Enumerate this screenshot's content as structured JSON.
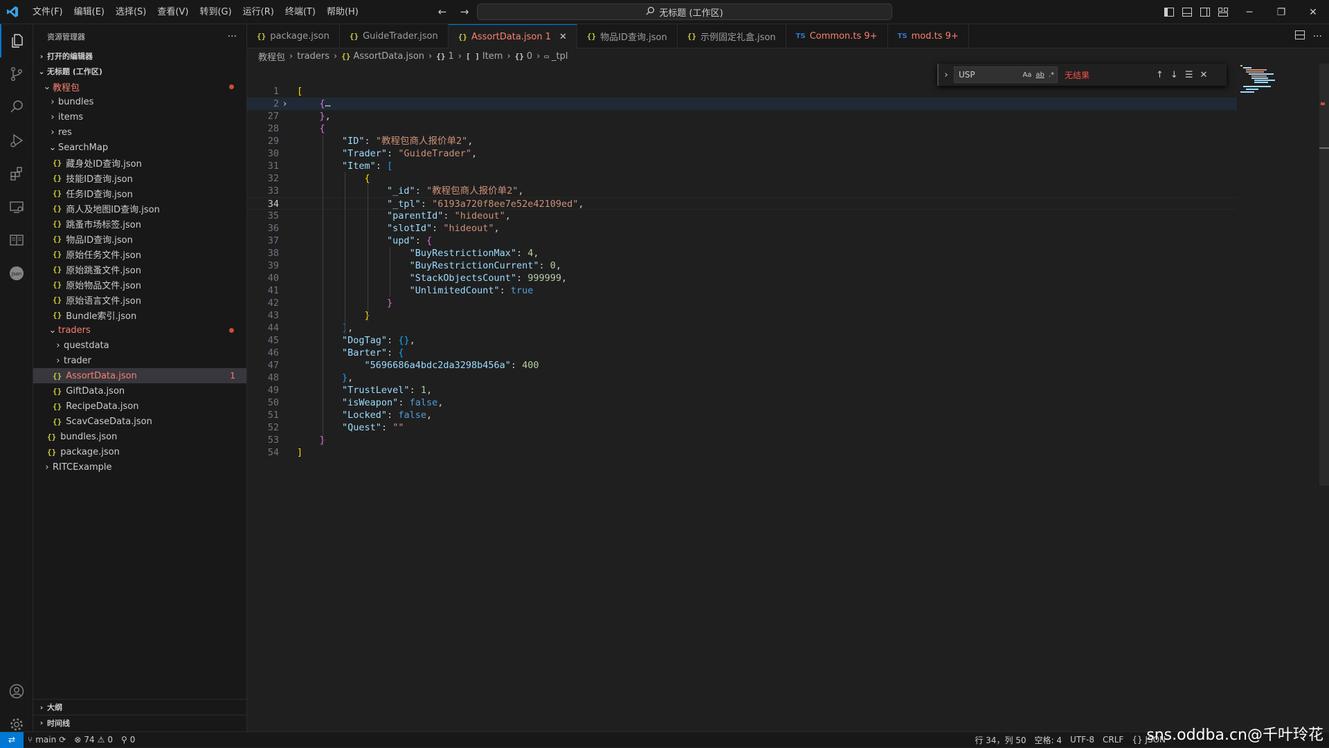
{
  "titlebar": {
    "menus": [
      "文件(F)",
      "编辑(E)",
      "选择(S)",
      "查看(V)",
      "转到(G)",
      "运行(R)",
      "终端(T)",
      "帮助(H)"
    ],
    "search_text": "无标题 (工作区)"
  },
  "sidebar": {
    "title": "资源管理器",
    "open_editors": "打开的编辑器",
    "workspace": "无标题 (工作区)",
    "root_folder": "教程包",
    "tree": [
      {
        "label": "bundles",
        "depth": 2,
        "type": "folder"
      },
      {
        "label": "items",
        "depth": 2,
        "type": "folder"
      },
      {
        "label": "res",
        "depth": 2,
        "type": "folder"
      },
      {
        "label": "SearchMap",
        "depth": 2,
        "type": "folder-open"
      },
      {
        "label": "藏身处ID查询.json",
        "depth": 3,
        "type": "json"
      },
      {
        "label": "技能ID查询.json",
        "depth": 3,
        "type": "json"
      },
      {
        "label": "任务ID查询.json",
        "depth": 3,
        "type": "json"
      },
      {
        "label": "商人及地图ID查询.json",
        "depth": 3,
        "type": "json"
      },
      {
        "label": "跳蚤市场标签.json",
        "depth": 3,
        "type": "json"
      },
      {
        "label": "物品ID查询.json",
        "depth": 3,
        "type": "json"
      },
      {
        "label": "原始任务文件.json",
        "depth": 3,
        "type": "json"
      },
      {
        "label": "原始跳蚤文件.json",
        "depth": 3,
        "type": "json"
      },
      {
        "label": "原始物品文件.json",
        "depth": 3,
        "type": "json"
      },
      {
        "label": "原始语言文件.json",
        "depth": 3,
        "type": "json"
      },
      {
        "label": "Bundle索引.json",
        "depth": 3,
        "type": "json"
      },
      {
        "label": "traders",
        "depth": 2,
        "type": "folder-open-err"
      },
      {
        "label": "questdata",
        "depth": 3,
        "type": "folder"
      },
      {
        "label": "trader",
        "depth": 3,
        "type": "folder"
      },
      {
        "label": "AssortData.json",
        "depth": 3,
        "type": "json-selected",
        "badge": "1"
      },
      {
        "label": "GiftData.json",
        "depth": 3,
        "type": "json"
      },
      {
        "label": "RecipeData.json",
        "depth": 3,
        "type": "json"
      },
      {
        "label": "ScavCaseData.json",
        "depth": 3,
        "type": "json"
      },
      {
        "label": "bundles.json",
        "depth": 2,
        "type": "json"
      },
      {
        "label": "package.json",
        "depth": 2,
        "type": "json"
      },
      {
        "label": "RITCExample",
        "depth": 1,
        "type": "folder"
      }
    ],
    "outline": "大纲",
    "timeline": "时间线"
  },
  "tabs": [
    {
      "label": "package.json",
      "icon": "{}",
      "active": false,
      "kind": "json"
    },
    {
      "label": "GuideTrader.json",
      "icon": "{}",
      "active": false,
      "kind": "json"
    },
    {
      "label": "AssortData.json 1",
      "icon": "{}",
      "active": true,
      "kind": "json"
    },
    {
      "label": "物品ID查询.json",
      "icon": "{}",
      "active": false,
      "kind": "json"
    },
    {
      "label": "示例固定礼盒.json",
      "icon": "{}",
      "active": false,
      "kind": "json"
    },
    {
      "label": "Common.ts 9+",
      "icon": "TS",
      "active": false,
      "kind": "ts"
    },
    {
      "label": "mod.ts 9+",
      "icon": "TS",
      "active": false,
      "kind": "ts"
    }
  ],
  "breadcrumb": [
    "教程包",
    "traders",
    "AssortData.json",
    "1",
    "Item",
    "0",
    "_tpl"
  ],
  "find": {
    "query": "USP",
    "opts": [
      "Aa",
      "ab",
      ".*"
    ],
    "result": "无结果"
  },
  "editor": {
    "current_line": "34",
    "lines": [
      {
        "n": "1",
        "html": "<span class='br1'>[</span>"
      },
      {
        "n": "2",
        "html": "    <span class='br2'>{</span><span class='p'>…</span>",
        "fold": true
      },
      {
        "n": "27",
        "html": "    <span class='br2'>}</span><span class='p'>,</span>"
      },
      {
        "n": "28",
        "html": "    <span class='br2'>{</span>"
      },
      {
        "n": "29",
        "html": "        <span class='k'>\"ID\"</span><span class='p'>: </span><span class='s'>\"教程包商人报价单2\"</span><span class='p'>,</span>"
      },
      {
        "n": "30",
        "html": "        <span class='k'>\"Trader\"</span><span class='p'>: </span><span class='s'>\"GuideTrader\"</span><span class='p'>,</span>"
      },
      {
        "n": "31",
        "html": "        <span class='k'>\"Item\"</span><span class='p'>: </span><span class='br3'>[</span>"
      },
      {
        "n": "32",
        "html": "            <span class='br1'>{</span>"
      },
      {
        "n": "33",
        "html": "                <span class='k'>\"_id\"</span><span class='p'>: </span><span class='s'>\"教程包商人报价单2\"</span><span class='p'>,</span>"
      },
      {
        "n": "34",
        "html": "                <span class='k'>\"_tpl\"</span><span class='p'>: </span><span class='s'>\"6193a720f8ee7e52e42109ed\"</span><span class='p'>,</span>",
        "current": true
      },
      {
        "n": "35",
        "html": "                <span class='k'>\"parentId\"</span><span class='p'>: </span><span class='s'>\"hideout\"</span><span class='p'>,</span>"
      },
      {
        "n": "36",
        "html": "                <span class='k'>\"slotId\"</span><span class='p'>: </span><span class='s'>\"hideout\"</span><span class='p'>,</span>"
      },
      {
        "n": "37",
        "html": "                <span class='k'>\"upd\"</span><span class='p'>: </span><span class='br2'>{</span>"
      },
      {
        "n": "38",
        "html": "                    <span class='k'>\"BuyRestrictionMax\"</span><span class='p'>: </span><span class='n'>4</span><span class='p'>,</span>"
      },
      {
        "n": "39",
        "html": "                    <span class='k'>\"BuyRestrictionCurrent\"</span><span class='p'>: </span><span class='n'>0</span><span class='p'>,</span>"
      },
      {
        "n": "40",
        "html": "                    <span class='k'>\"StackObjectsCount\"</span><span class='p'>: </span><span class='n'>999999</span><span class='p'>,</span>"
      },
      {
        "n": "41",
        "html": "                    <span class='k'>\"UnlimitedCount\"</span><span class='p'>: </span><span class='b'>true</span>"
      },
      {
        "n": "42",
        "html": "                <span class='br2'>}</span>"
      },
      {
        "n": "43",
        "html": "            <span class='br1'>}</span>"
      },
      {
        "n": "44",
        "html": "        <span class='br3'>]</span><span class='p'>,</span>"
      },
      {
        "n": "45",
        "html": "        <span class='k'>\"DogTag\"</span><span class='p'>: </span><span class='br3'>{}</span><span class='p'>,</span>"
      },
      {
        "n": "46",
        "html": "        <span class='k'>\"Barter\"</span><span class='p'>: </span><span class='br3'>{</span>"
      },
      {
        "n": "47",
        "html": "            <span class='k'>\"5696686a4bdc2da3298b456a\"</span><span class='p'>: </span><span class='n'>400</span>"
      },
      {
        "n": "48",
        "html": "        <span class='br3'>}</span><span class='p'>,</span>"
      },
      {
        "n": "49",
        "html": "        <span class='k'>\"TrustLevel\"</span><span class='p'>: </span><span class='n'>1</span><span class='p'>,</span>"
      },
      {
        "n": "50",
        "html": "        <span class='k'>\"isWeapon\"</span><span class='p'>: </span><span class='b'>false</span><span class='p'>,</span>"
      },
      {
        "n": "51",
        "html": "        <span class='k'>\"Locked\"</span><span class='p'>: </span><span class='b'>false</span><span class='p'>,</span>"
      },
      {
        "n": "52",
        "html": "        <span class='k'>\"Quest\"</span><span class='p'>: </span><span class='s'>\"\"</span>"
      },
      {
        "n": "53",
        "html": "    <span class='br2'>}</span>"
      },
      {
        "n": "54",
        "html": "<span class='br1'>]</span>"
      }
    ]
  },
  "statusbar": {
    "branch": "main",
    "errors": "74",
    "warnings": "0",
    "ports": "0",
    "position": "行 34，列 50",
    "spaces": "空格: 4",
    "encoding": "UTF-8",
    "eol": "CRLF",
    "language": "{} JSON"
  },
  "watermark": "sns.oddba.cn@千叶玲花"
}
